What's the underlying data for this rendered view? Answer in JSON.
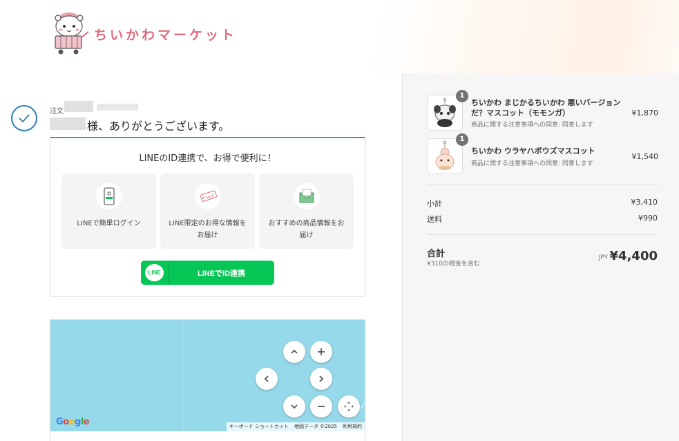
{
  "brand": {
    "name": "ちいかわマーケット",
    "accent": "#e06c7b"
  },
  "confirmation": {
    "order_label": "注文",
    "thanks": "様、ありがとうございます。",
    "check_color": "#2c7db3"
  },
  "line_promo": {
    "title": "LINEのID連携で、お得で便利に！",
    "features": [
      {
        "icon": "smartphone-login-icon",
        "text": "LINEで簡単ログイン"
      },
      {
        "icon": "sale-tag-icon",
        "text": "LINE限定のお得な情報をお届け"
      },
      {
        "icon": "envelope-icon",
        "text": "おすすめの商品情報をお届け"
      }
    ],
    "button_logo": "LINE",
    "button_label": "LINEでID連携",
    "button_color": "#06c755"
  },
  "map": {
    "google_logo": "Google",
    "attribution": [
      "キーボード ショートカット",
      "地図データ ©2025",
      "利用規約"
    ],
    "water_color": "#96d9ea"
  },
  "summary": {
    "items": [
      {
        "qty": "1",
        "name": "ちいかわ まじかるちいかわ 悪いバージョンだ？マスコット（モモンガ）",
        "note": "商品に関する注意事項への同意: 同意します",
        "price": "¥1,870"
      },
      {
        "qty": "1",
        "name": "ちいかわ ウラヤハボウズマスコット",
        "note": "商品に関する注意事項への同意: 同意します",
        "price": "¥1,540"
      }
    ],
    "subtotal_label": "小計",
    "subtotal": "¥3,410",
    "shipping_label": "送料",
    "shipping": "¥990",
    "total_label": "合計",
    "tax_note": "¥310の税金を含む",
    "currency": "JPY",
    "total": "¥4,400"
  }
}
